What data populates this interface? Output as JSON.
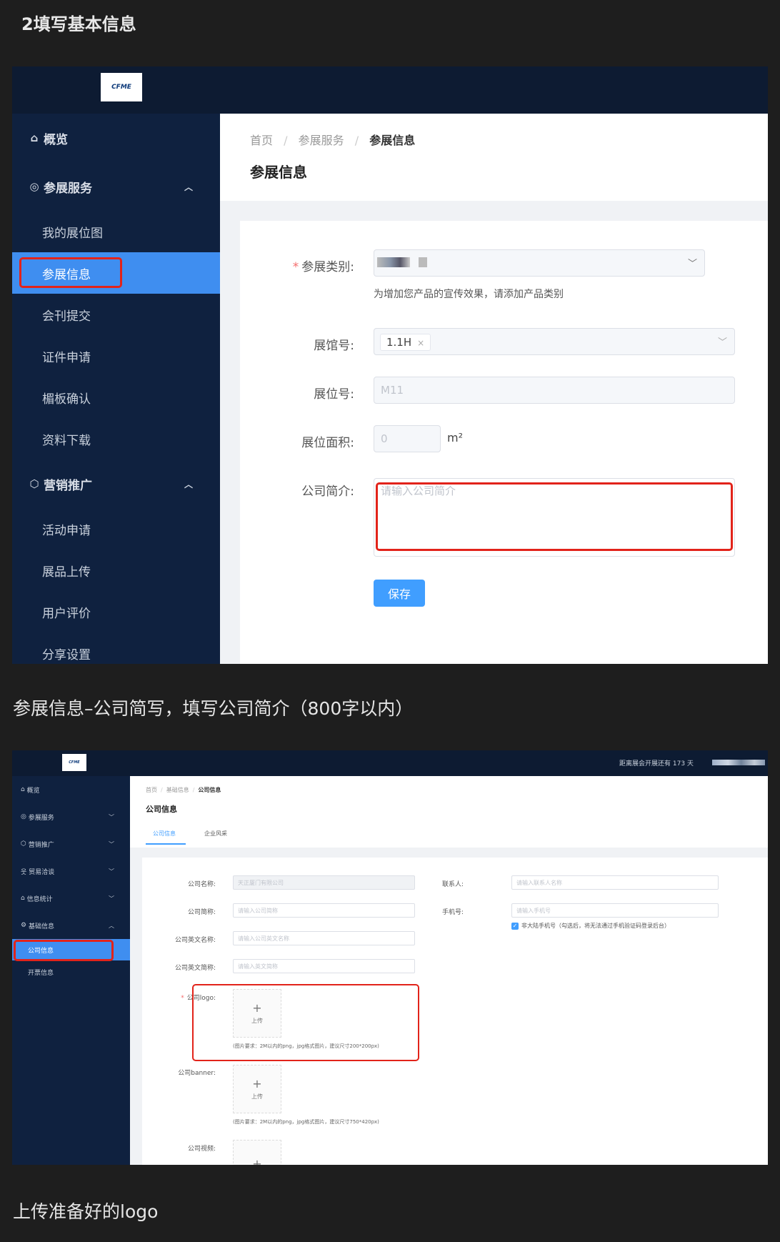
{
  "step_heading": "2填写基本信息",
  "screen1": {
    "logo_text": "CFME",
    "sidebar": {
      "overview": "概览",
      "exhibit_services": "参展服务",
      "exhibit_items": [
        "我的展位图",
        "参展信息",
        "会刊提交",
        "证件申请",
        "楣板确认",
        "资料下载"
      ],
      "marketing": "营销推广",
      "marketing_items": [
        "活动申请",
        "展品上传",
        "用户评价",
        "分享设置"
      ]
    },
    "breadcrumb": [
      "首页",
      "参展服务",
      "参展信息"
    ],
    "page_title": "参展信息",
    "form": {
      "category_label": "参展类别:",
      "category_hint": "为增加您产品的宣传效果，请添加产品类别",
      "hall_label": "展馆号:",
      "hall_tag": "1.1H",
      "booth_label": "展位号:",
      "booth_value": "M11",
      "area_label": "展位面积:",
      "area_value": "0",
      "area_unit": "m²",
      "intro_label": "公司简介:",
      "intro_placeholder": "请输入公司简介",
      "save_button": "保存"
    }
  },
  "caption1": "参展信息–公司简写，填写公司简介（800字以内）",
  "screen2": {
    "logo_text": "CFME",
    "topbar_notice": "距离展会开展还有 173 天",
    "sidebar": {
      "items": [
        "概览",
        "参展服务",
        "营销推广",
        "贸易洽谈",
        "信息统计",
        "基础信息"
      ],
      "sub_items": [
        "公司信息",
        "开票信息"
      ]
    },
    "breadcrumb": [
      "首页",
      "基础信息",
      "公司信息"
    ],
    "page_title": "公司信息",
    "tabs": [
      "公司信息",
      "企业风采"
    ],
    "form": {
      "company_name_label": "公司名称:",
      "company_name_value": "天正厦门有限公司",
      "short_name_label": "公司简称:",
      "short_name_ph": "请输入公司简称",
      "en_name_label": "公司英文名称:",
      "en_name_ph": "请输入公司英文名称",
      "en_short_label": "公司英文简称:",
      "en_short_ph": "请输入英文简称",
      "logo_label": "公司logo:",
      "upload_text": "上传",
      "logo_req": "(图片要求：2M以内的png，jpg格式图片，建议尺寸200*200px)",
      "banner_label": "公司banner:",
      "banner_req": "(图片要求：2M以内的png，jpg格式图片，建议尺寸750*420px)",
      "video_label": "公司视频:",
      "contact_label": "联系人:",
      "contact_ph": "请输入联系人名称",
      "phone_label": "手机号:",
      "phone_ph": "请输入手机号",
      "non_mainland": "非大陆手机号（勾选后，将无法通过手机验证码登录后台）"
    }
  },
  "caption2": "上传准备好的logo"
}
